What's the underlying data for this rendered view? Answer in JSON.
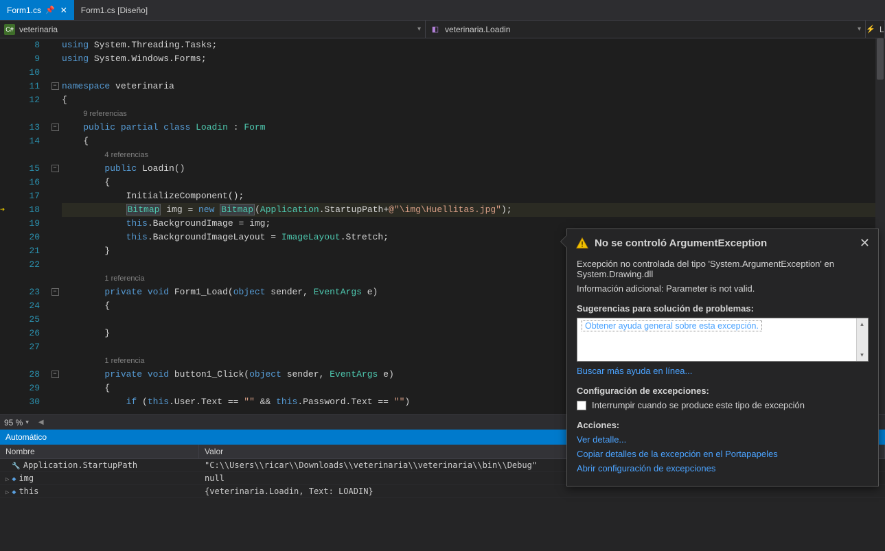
{
  "tabs": [
    {
      "label": "Form1.cs",
      "active": true,
      "pinned": true
    },
    {
      "label": "Form1.cs [Diseño]",
      "active": false
    }
  ],
  "nav": {
    "left": "veterinaria",
    "middle": "veterinaria.Loadin",
    "right": "L"
  },
  "zoom": {
    "value": "95 %"
  },
  "code": {
    "lines": [
      {
        "n": 8,
        "fold": "",
        "html": "<span class='kw'>using</span> System.Threading.Tasks;"
      },
      {
        "n": 9,
        "fold": "",
        "html": "<span class='kw'>using</span> System.Windows.Forms;"
      },
      {
        "n": 10,
        "fold": "",
        "html": ""
      },
      {
        "n": 11,
        "fold": "box",
        "html": "<span class='kw'>namespace</span> <span class='ident'>veterinaria</span>"
      },
      {
        "n": 12,
        "fold": "",
        "html": "{"
      },
      {
        "n": 0,
        "fold": "",
        "html": "    <span class='refs'>9 referencias</span>"
      },
      {
        "n": 13,
        "fold": "box",
        "html": "    <span class='kw'>public</span> <span class='kw'>partial</span> <span class='kw'>class</span> <span class='type'>Loadin</span> : <span class='type'>Form</span>"
      },
      {
        "n": 14,
        "fold": "",
        "html": "    {"
      },
      {
        "n": 0,
        "fold": "",
        "html": "        <span class='refs'>4 referencias</span>"
      },
      {
        "n": 15,
        "fold": "box",
        "html": "        <span class='kw'>public</span> Loadin()"
      },
      {
        "n": 16,
        "fold": "",
        "html": "        {"
      },
      {
        "n": 17,
        "fold": "",
        "html": "            InitializeComponent();"
      },
      {
        "n": 18,
        "fold": "",
        "hl": true,
        "break": true,
        "html": "            <span class='hl-type'>Bitmap</span> img = <span class='kw'>new</span> <span class='hl-type'>Bitmap</span>(<span class='type'>Application</span>.StartupPath+<span class='str'>@\"\\img\\Huellitas.jpg\"</span>);"
      },
      {
        "n": 19,
        "fold": "",
        "html": "            <span class='kw'>this</span>.BackgroundImage = img;"
      },
      {
        "n": 20,
        "fold": "",
        "html": "            <span class='kw'>this</span>.BackgroundImageLayout = <span class='type'>ImageLayout</span>.Stretch;"
      },
      {
        "n": 21,
        "fold": "",
        "html": "        }"
      },
      {
        "n": 22,
        "fold": "",
        "html": ""
      },
      {
        "n": 0,
        "fold": "",
        "html": "        <span class='refs'>1 referencia</span>"
      },
      {
        "n": 23,
        "fold": "box",
        "html": "        <span class='kw'>private</span> <span class='kw'>void</span> Form1_Load(<span class='kw'>object</span> sender, <span class='type'>EventArgs</span> e)"
      },
      {
        "n": 24,
        "fold": "",
        "html": "        {"
      },
      {
        "n": 25,
        "fold": "",
        "html": ""
      },
      {
        "n": 26,
        "fold": "",
        "html": "        }"
      },
      {
        "n": 27,
        "fold": "",
        "html": ""
      },
      {
        "n": 0,
        "fold": "",
        "html": "        <span class='refs'>1 referencia</span>"
      },
      {
        "n": 28,
        "fold": "box",
        "html": "        <span class='kw'>private</span> <span class='kw'>void</span> button1_Click(<span class='kw'>object</span> sender, <span class='type'>EventArgs</span> e)"
      },
      {
        "n": 29,
        "fold": "",
        "html": "        {"
      },
      {
        "n": 30,
        "fold": "",
        "html": "            <span class='kw'>if</span> (<span class='kw'>this</span>.User.Text == <span class='str'>\"\"</span> && <span class='kw'>this</span>.Password.Text == <span class='str'>\"\"</span>)"
      }
    ]
  },
  "autos": {
    "title": "Automático",
    "colName": "Nombre",
    "colVal": "Valor",
    "rows": [
      {
        "name": "Application.StartupPath",
        "icon": "wrench",
        "value": "\"C:\\\\Users\\\\ricar\\\\Downloads\\\\veterinaria\\\\veterinaria\\\\bin\\\\Debug\""
      },
      {
        "name": "img",
        "icon": "var",
        "value": "null"
      },
      {
        "name": "this",
        "icon": "var",
        "value": "{veterinaria.Loadin, Text: LOADIN}"
      }
    ]
  },
  "exception": {
    "title": "No se controló ArgumentException",
    "line1": "Excepción no controlada del tipo 'System.ArgumentException' en System.Drawing.dll",
    "line2": "Información adicional: Parameter is not valid.",
    "sugHeader": "Sugerencias para solución de problemas:",
    "sugLink": "Obtener ayuda general sobre esta excepción.",
    "moreHelp": "Buscar más ayuda en línea...",
    "configHeader": "Configuración de excepciones:",
    "checkLabel": "Interrumpir cuando se produce este tipo de excepción",
    "actionsHeader": "Acciones:",
    "actions": [
      "Ver detalle...",
      "Copiar detalles de la excepción en el Portapapeles",
      "Abrir configuración de excepciones"
    ]
  }
}
